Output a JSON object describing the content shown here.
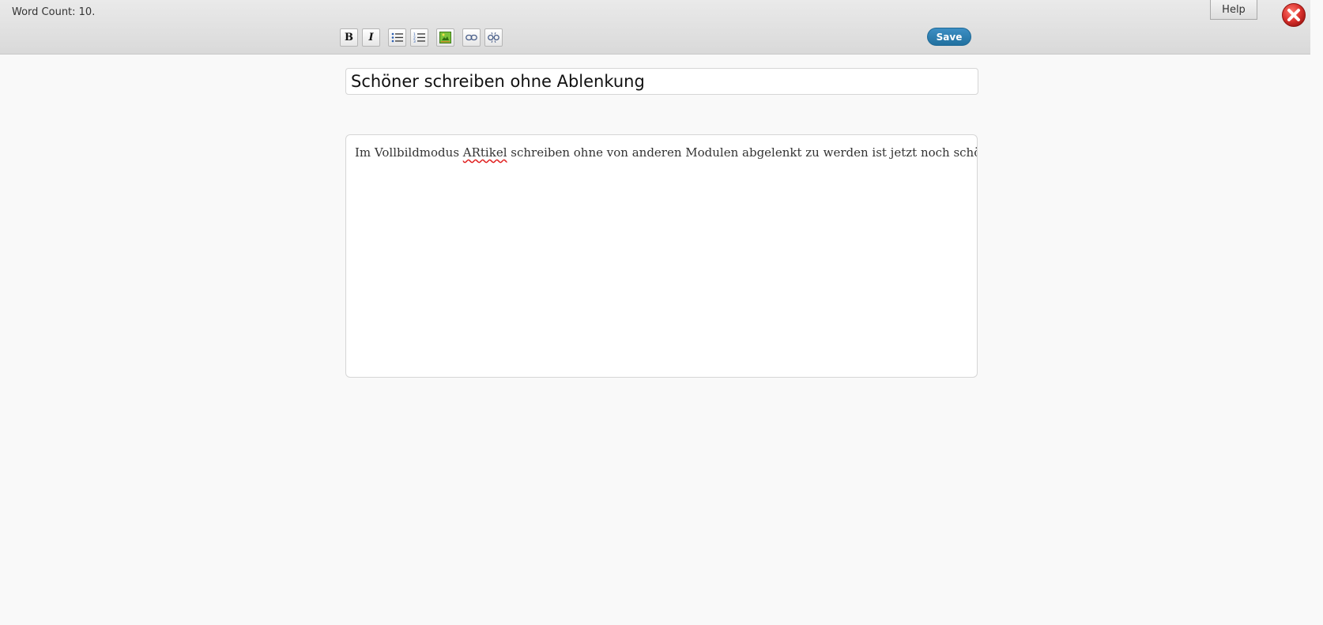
{
  "header": {
    "word_count": "Word Count: 10.",
    "help_label": "Help",
    "save_label": "Save"
  },
  "toolbar": {
    "bold_glyph": "B",
    "italic_glyph": "I",
    "buttons": [
      "bold-icon",
      "italic-icon",
      "bullet-list-icon",
      "numbered-list-icon",
      "insert-image-icon",
      "link-icon",
      "unlink-icon"
    ]
  },
  "document": {
    "title": "Schöner schreiben ohne Ablenkung",
    "body_before": "Im Vollbildmodus ",
    "body_misspelled": "ARtikel",
    "body_after": " schreiben ohne von anderen Modulen abgelenkt zu werden ist jetzt noch schöner"
  },
  "colors": {
    "accent": "#2a7bb0",
    "close": "#d9302c",
    "spellcheck": "#e02020"
  }
}
